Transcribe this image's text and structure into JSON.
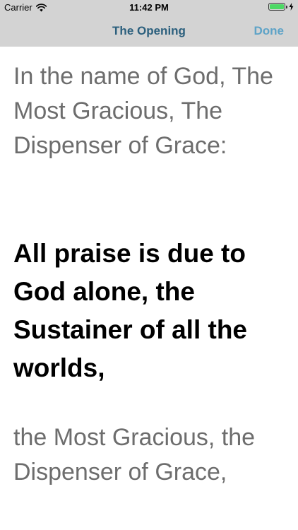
{
  "status_bar": {
    "carrier": "Carrier",
    "time": "11:42 PM",
    "battery_level": 1.0,
    "battery_color": "#4cd964",
    "icons": [
      "wifi-icon",
      "battery-icon",
      "charging-bolt-icon"
    ]
  },
  "nav": {
    "title": "The Opening",
    "done_label": "Done",
    "title_color": "#2b5f7d",
    "done_color": "#5ea3c7",
    "bar_color": "#d3d3d3"
  },
  "verses": [
    {
      "text": "In the name of God, The Most Gracious, The Dispenser of Grace:",
      "style": "light"
    },
    {
      "text": "All praise is due to God alone, the Sustainer of all the worlds,",
      "style": "bold"
    },
    {
      "text": "the Most Gracious, the Dispenser of Grace,",
      "style": "light"
    }
  ]
}
